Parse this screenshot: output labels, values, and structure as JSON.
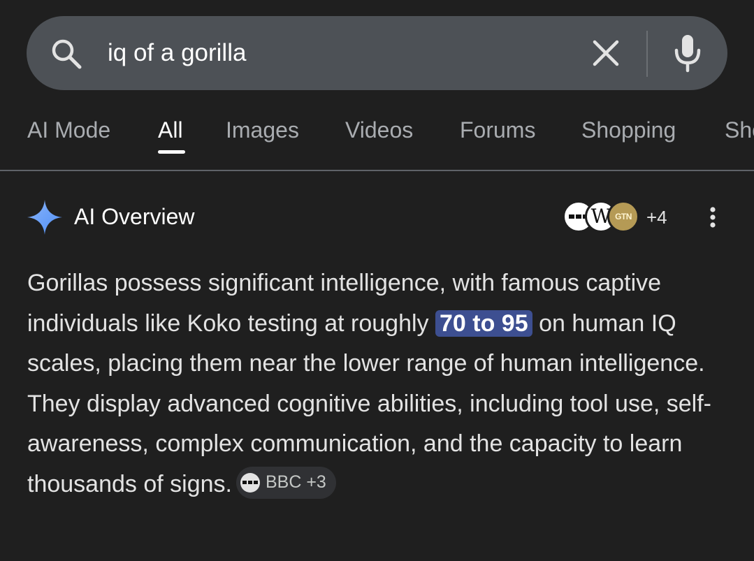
{
  "search": {
    "query": "iq of a gorilla"
  },
  "tabs": [
    {
      "label": "AI Mode",
      "active": false
    },
    {
      "label": "All",
      "active": true
    },
    {
      "label": "Images",
      "active": false
    },
    {
      "label": "Videos",
      "active": false
    },
    {
      "label": "Forums",
      "active": false
    },
    {
      "label": "Shopping",
      "active": false
    },
    {
      "label": "Sho",
      "active": false
    }
  ],
  "ai_overview": {
    "title": "AI Overview",
    "sources": [
      {
        "icon": "bbc-logo",
        "label": ""
      },
      {
        "icon": "wikipedia-logo",
        "label": "W"
      },
      {
        "icon": "gtn-logo",
        "label": "GTN"
      }
    ],
    "more_sources": "+4",
    "text_before": "Gorillas possess significant intelligence, with famous captive individuals like Koko testing at roughly ",
    "highlight": "70 to 95",
    "text_after": " on human IQ scales, placing them near the lower range of human intelligence. They display advanced cognitive abilities, including tool use, self-awareness, complex communication, and the capacity to learn thousands of signs.",
    "citation": {
      "icon": "bbc-logo",
      "label": "BBC +3"
    }
  },
  "colors": {
    "background": "#1f1f1f",
    "search_bar": "#4d5156",
    "highlight": "#3d4f91",
    "sparkle": "#4f8ff7"
  }
}
